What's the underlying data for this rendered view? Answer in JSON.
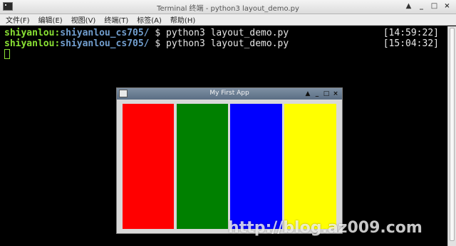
{
  "terminal": {
    "title": "Terminal 终端 - python3 layout_demo.py",
    "menu": [
      "文件(F)",
      "编辑(E)",
      "视图(V)",
      "终端(T)",
      "标签(A)",
      "帮助(H)"
    ],
    "window_buttons": [
      "▲",
      "_",
      "□",
      "×"
    ],
    "lines": [
      {
        "user": "shiyanlou",
        "sep": ":",
        "path": "shiyanlou_cs705/",
        "cmd": " $ python3 layout_demo.py",
        "time": "[14:59:22]"
      },
      {
        "user": "shiyanlou",
        "sep": ":",
        "path": "shiyanlou_cs705/",
        "cmd": " $ python3 layout_demo.py",
        "time": "[15:04:32]"
      }
    ]
  },
  "app": {
    "title": "My First App",
    "window_buttons": [
      "▲",
      "_",
      "□",
      "×"
    ],
    "bars": [
      {
        "color_name": "red",
        "color": "#ff0000"
      },
      {
        "color_name": "green",
        "color": "#008000"
      },
      {
        "color_name": "blue",
        "color": "#0000ff"
      },
      {
        "color_name": "yellow",
        "color": "#ffff00"
      }
    ]
  },
  "watermark": "http://blog.az009.com",
  "colors": {
    "prompt_user": "#8ae234",
    "prompt_path": "#729fcf",
    "terminal_bg": "#000000",
    "app_titlebar": "#5b6e84"
  }
}
